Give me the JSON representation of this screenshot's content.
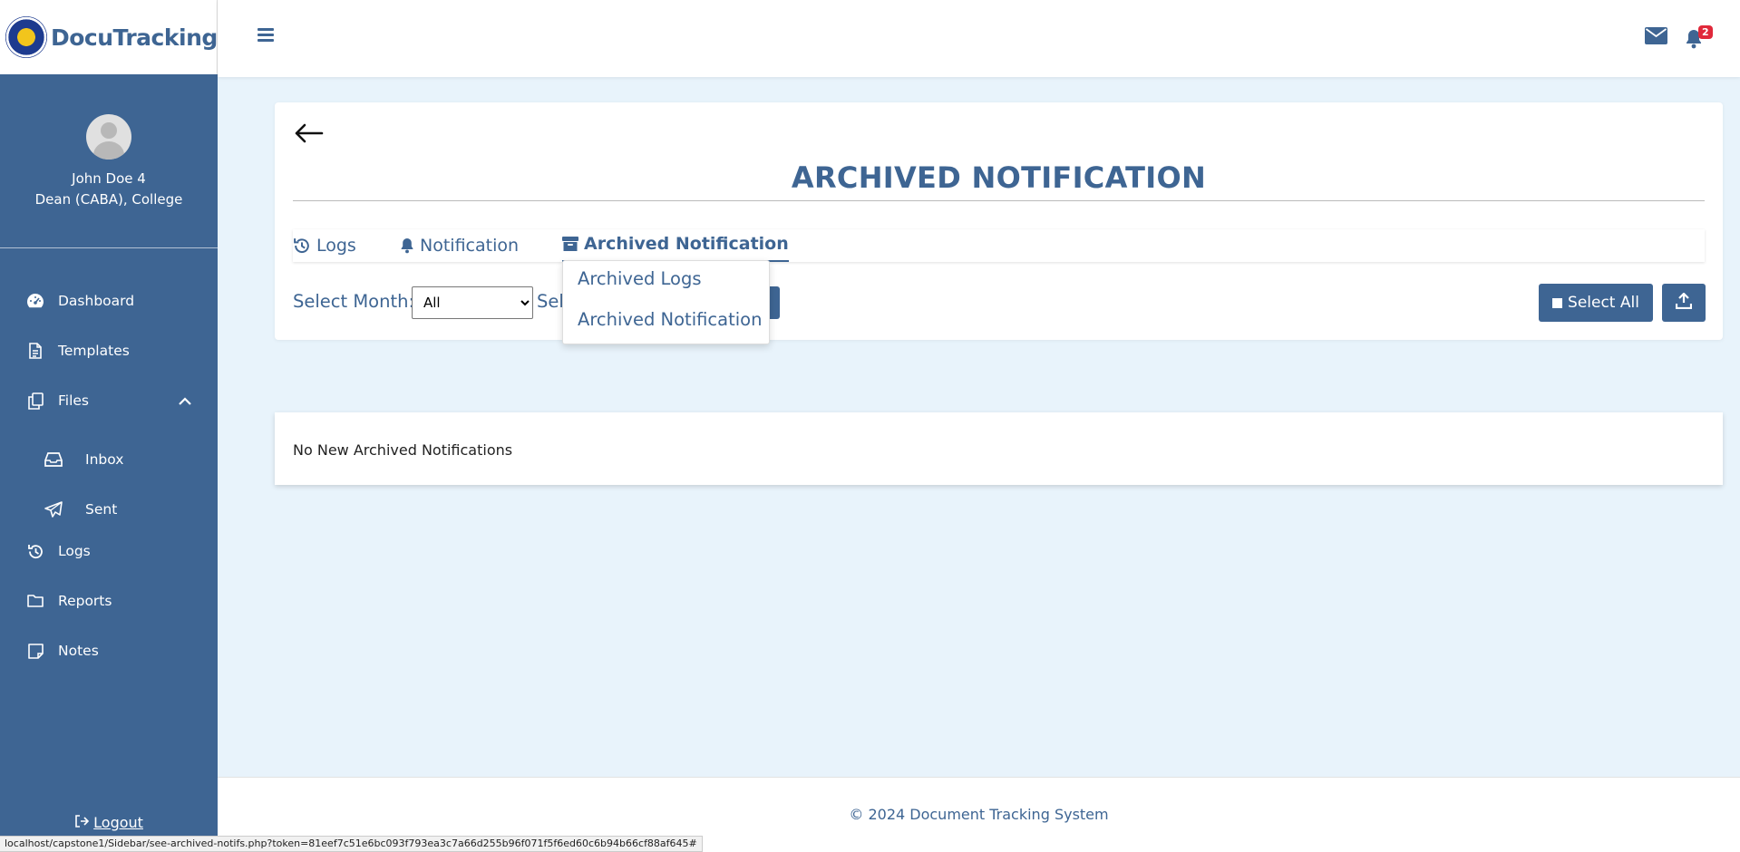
{
  "brand": {
    "name": "DocuTracking",
    "logo_icon": "university-seal-icon"
  },
  "user": {
    "name": "John Doe 4",
    "role": "Dean (CABA), College"
  },
  "sidebar": {
    "items": [
      {
        "label": "Dashboard",
        "icon": "dashboard-gauge-icon"
      },
      {
        "label": "Templates",
        "icon": "document-icon"
      },
      {
        "label": "Files",
        "icon": "files-copy-icon"
      },
      {
        "label": "Inbox",
        "icon": "inbox-tray-icon"
      },
      {
        "label": "Sent",
        "icon": "paper-plane-icon"
      },
      {
        "label": "Logs",
        "icon": "history-icon"
      },
      {
        "label": "Reports",
        "icon": "folder-icon"
      },
      {
        "label": "Notes",
        "icon": "sticky-note-icon"
      }
    ],
    "logout_label": "Logout"
  },
  "header": {
    "notification_count": "2"
  },
  "main": {
    "title": "ARCHIVED NOTIFICATION",
    "tabs": [
      {
        "label": "Logs",
        "icon": "history-icon"
      },
      {
        "label": "Notification",
        "icon": "bell-icon"
      },
      {
        "label": "Archived Notification",
        "icon": "archive-box-icon",
        "active": true
      }
    ],
    "dropdown": [
      {
        "label": "Archived Logs"
      },
      {
        "label": "Archived Notification"
      }
    ],
    "filter": {
      "month_label": "Select Month:",
      "month_value": "All",
      "second_label": "Sel"
    },
    "select_all_label": "Select All",
    "empty_message": "No New Archived Notifications"
  },
  "footer": {
    "text": "© 2024 Document Tracking System"
  },
  "statusbar": {
    "url": "localhost/capstone1/Sidebar/see-archived-notifs.php?token=81eef7c51e6bc093f793ea3c7a66d255b96f071f5f6ed60c6b94b66cf88af645#"
  },
  "colors": {
    "primary": "#3e6593",
    "background": "#e8f3fb",
    "badge": "#e0283a"
  }
}
